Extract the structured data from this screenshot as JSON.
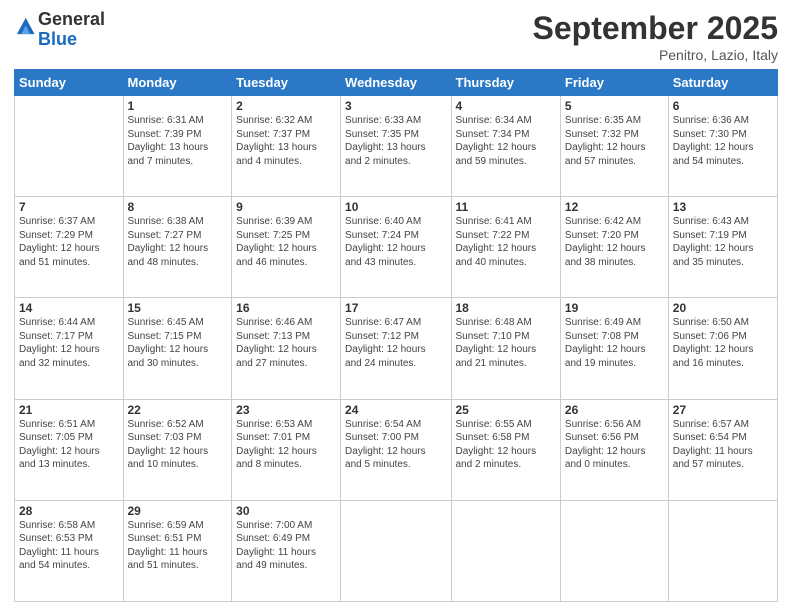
{
  "logo": {
    "general": "General",
    "blue": "Blue"
  },
  "header": {
    "month": "September 2025",
    "location": "Penitro, Lazio, Italy"
  },
  "days_of_week": [
    "Sunday",
    "Monday",
    "Tuesday",
    "Wednesday",
    "Thursday",
    "Friday",
    "Saturday"
  ],
  "weeks": [
    [
      {
        "day": "",
        "info": ""
      },
      {
        "day": "1",
        "info": "Sunrise: 6:31 AM\nSunset: 7:39 PM\nDaylight: 13 hours\nand 7 minutes."
      },
      {
        "day": "2",
        "info": "Sunrise: 6:32 AM\nSunset: 7:37 PM\nDaylight: 13 hours\nand 4 minutes."
      },
      {
        "day": "3",
        "info": "Sunrise: 6:33 AM\nSunset: 7:35 PM\nDaylight: 13 hours\nand 2 minutes."
      },
      {
        "day": "4",
        "info": "Sunrise: 6:34 AM\nSunset: 7:34 PM\nDaylight: 12 hours\nand 59 minutes."
      },
      {
        "day": "5",
        "info": "Sunrise: 6:35 AM\nSunset: 7:32 PM\nDaylight: 12 hours\nand 57 minutes."
      },
      {
        "day": "6",
        "info": "Sunrise: 6:36 AM\nSunset: 7:30 PM\nDaylight: 12 hours\nand 54 minutes."
      }
    ],
    [
      {
        "day": "7",
        "info": "Sunrise: 6:37 AM\nSunset: 7:29 PM\nDaylight: 12 hours\nand 51 minutes."
      },
      {
        "day": "8",
        "info": "Sunrise: 6:38 AM\nSunset: 7:27 PM\nDaylight: 12 hours\nand 48 minutes."
      },
      {
        "day": "9",
        "info": "Sunrise: 6:39 AM\nSunset: 7:25 PM\nDaylight: 12 hours\nand 46 minutes."
      },
      {
        "day": "10",
        "info": "Sunrise: 6:40 AM\nSunset: 7:24 PM\nDaylight: 12 hours\nand 43 minutes."
      },
      {
        "day": "11",
        "info": "Sunrise: 6:41 AM\nSunset: 7:22 PM\nDaylight: 12 hours\nand 40 minutes."
      },
      {
        "day": "12",
        "info": "Sunrise: 6:42 AM\nSunset: 7:20 PM\nDaylight: 12 hours\nand 38 minutes."
      },
      {
        "day": "13",
        "info": "Sunrise: 6:43 AM\nSunset: 7:19 PM\nDaylight: 12 hours\nand 35 minutes."
      }
    ],
    [
      {
        "day": "14",
        "info": "Sunrise: 6:44 AM\nSunset: 7:17 PM\nDaylight: 12 hours\nand 32 minutes."
      },
      {
        "day": "15",
        "info": "Sunrise: 6:45 AM\nSunset: 7:15 PM\nDaylight: 12 hours\nand 30 minutes."
      },
      {
        "day": "16",
        "info": "Sunrise: 6:46 AM\nSunset: 7:13 PM\nDaylight: 12 hours\nand 27 minutes."
      },
      {
        "day": "17",
        "info": "Sunrise: 6:47 AM\nSunset: 7:12 PM\nDaylight: 12 hours\nand 24 minutes."
      },
      {
        "day": "18",
        "info": "Sunrise: 6:48 AM\nSunset: 7:10 PM\nDaylight: 12 hours\nand 21 minutes."
      },
      {
        "day": "19",
        "info": "Sunrise: 6:49 AM\nSunset: 7:08 PM\nDaylight: 12 hours\nand 19 minutes."
      },
      {
        "day": "20",
        "info": "Sunrise: 6:50 AM\nSunset: 7:06 PM\nDaylight: 12 hours\nand 16 minutes."
      }
    ],
    [
      {
        "day": "21",
        "info": "Sunrise: 6:51 AM\nSunset: 7:05 PM\nDaylight: 12 hours\nand 13 minutes."
      },
      {
        "day": "22",
        "info": "Sunrise: 6:52 AM\nSunset: 7:03 PM\nDaylight: 12 hours\nand 10 minutes."
      },
      {
        "day": "23",
        "info": "Sunrise: 6:53 AM\nSunset: 7:01 PM\nDaylight: 12 hours\nand 8 minutes."
      },
      {
        "day": "24",
        "info": "Sunrise: 6:54 AM\nSunset: 7:00 PM\nDaylight: 12 hours\nand 5 minutes."
      },
      {
        "day": "25",
        "info": "Sunrise: 6:55 AM\nSunset: 6:58 PM\nDaylight: 12 hours\nand 2 minutes."
      },
      {
        "day": "26",
        "info": "Sunrise: 6:56 AM\nSunset: 6:56 PM\nDaylight: 12 hours\nand 0 minutes."
      },
      {
        "day": "27",
        "info": "Sunrise: 6:57 AM\nSunset: 6:54 PM\nDaylight: 11 hours\nand 57 minutes."
      }
    ],
    [
      {
        "day": "28",
        "info": "Sunrise: 6:58 AM\nSunset: 6:53 PM\nDaylight: 11 hours\nand 54 minutes."
      },
      {
        "day": "29",
        "info": "Sunrise: 6:59 AM\nSunset: 6:51 PM\nDaylight: 11 hours\nand 51 minutes."
      },
      {
        "day": "30",
        "info": "Sunrise: 7:00 AM\nSunset: 6:49 PM\nDaylight: 11 hours\nand 49 minutes."
      },
      {
        "day": "",
        "info": ""
      },
      {
        "day": "",
        "info": ""
      },
      {
        "day": "",
        "info": ""
      },
      {
        "day": "",
        "info": ""
      }
    ]
  ]
}
